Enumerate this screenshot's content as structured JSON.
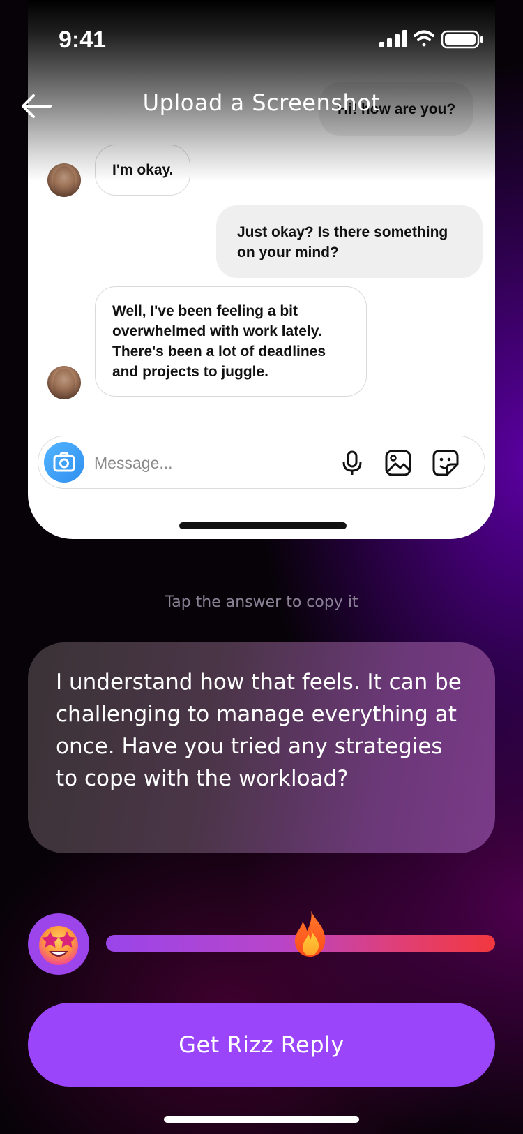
{
  "status_bar": {
    "time": "9:41"
  },
  "header": {
    "title": "Upload a Screenshot"
  },
  "chat": {
    "messages": [
      {
        "side": "out",
        "text": "Hi! how are you?"
      },
      {
        "side": "in",
        "text": "I'm okay."
      },
      {
        "side": "out",
        "text": "Just okay? Is there something on your mind?"
      },
      {
        "side": "in",
        "text": "Well, I've been feeling a bit overwhelmed with work lately. There's been a lot of deadlines and projects to juggle."
      }
    ],
    "composer_placeholder": "Message..."
  },
  "hint": "Tap the answer to copy it",
  "answer": "I understand how that feels. It can be challenging to manage everything at once. Have you tried any strategies to cope with the workload?",
  "rizz_slider": {
    "value": 0.5,
    "emoji": "star-struck-icon",
    "thumb": "fire-icon"
  },
  "cta_label": "Get Rizz Reply",
  "colors": {
    "accent": "#9b45fb",
    "slider_end": "#f2383f"
  }
}
